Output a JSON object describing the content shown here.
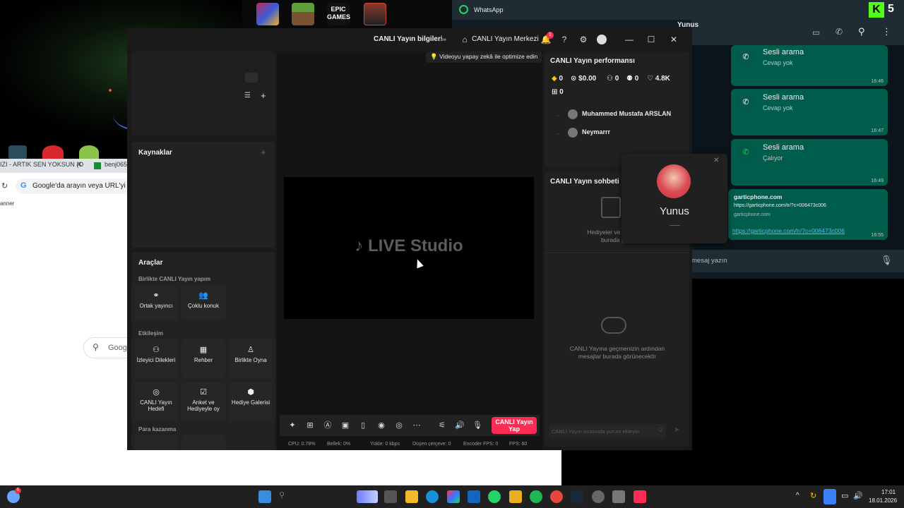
{
  "desktop": {
    "icons": [
      "game-icon-1",
      "minecraft-icon",
      "epic-games-icon",
      "game-icon-4"
    ],
    "epic_label": "EPIC\nGAMES"
  },
  "chrome": {
    "tabs": [
      "IZI - ARTIK SEN YOKSUN (O",
      "benj065"
    ],
    "omnibox": "Google'da arayın veya URL'yi yaz",
    "bookmark": "anner",
    "search_placeholder": "Goog"
  },
  "studio": {
    "titlebar": {
      "info": "CANLI Yayın bilgileri",
      "center": "CANLI Yayın Merkezi",
      "notif_count": "1"
    },
    "left": {
      "sources_title": "Kaynaklar",
      "tools_title": "Araçlar",
      "section_collab": "Birlikte CANLI Yayın yapım",
      "section_interact": "Etkileşim",
      "section_money": "Para kazanma",
      "collab_tools": [
        {
          "icon": "link-icon",
          "label": "Ortak yayıncı"
        },
        {
          "icon": "multi-guest-icon",
          "label": "Çoklu konuk"
        }
      ],
      "interact_tools": [
        {
          "icon": "viewer-requests-icon",
          "label": "İzleyici Dilekleri"
        },
        {
          "icon": "guide-icon",
          "label": "Rehber"
        },
        {
          "icon": "play-together-icon",
          "label": "Birlikte Oyna"
        },
        {
          "icon": "live-goal-icon",
          "label": "CANLI Yayın Hedefi"
        },
        {
          "icon": "poll-icon",
          "label": "Anket ve Hediyeyle oy"
        },
        {
          "icon": "gift-gallery-icon",
          "label": "Hediye Galerisi"
        }
      ]
    },
    "center": {
      "ai_tip": "Videoyu yapay zekâ ile optimize edin",
      "logo": "LIVE Studio",
      "go_live": "CANLI Yayın Yap",
      "status": {
        "cpu": "CPU: 0.78%",
        "memory": "Bellek: 0%",
        "upload": "Yükle: 0 kbps",
        "dropped": "Düşen çerçeve: 0",
        "encoder": "Encoder FPS: 0",
        "fps": "FPS: 60"
      }
    },
    "right": {
      "perf_title": "CANLI Yayın performansı",
      "stats": {
        "diamonds": "0",
        "money": "$0.00",
        "viewers": "0",
        "new_followers": "0",
        "likes": "4.8K",
        "gifts": "0"
      },
      "viewers": [
        "Muhammed Mustafa ARSLAN",
        "Neymarrr"
      ],
      "chat_title": "CANLI Yayın sohbeti",
      "gift_hint": "Hediyeler ve Süper Ha\nburada görü",
      "chat_hint": "CANLI Yayına geçmenizin ardından\nmesajlar burada görünecektir",
      "chat_input_placeholder": "CANLI Yayın sırasında yorum ekleyin"
    }
  },
  "whatsapp": {
    "title": "WhatsApp",
    "contact": "Yunus",
    "messages": [
      {
        "title": "Sesli arama",
        "sub": "Cevap yok",
        "time": "16:46"
      },
      {
        "title": "Sesli arama",
        "sub": "Cevap yok",
        "time": "16:47"
      },
      {
        "title": "Sesli arama",
        "sub": "Çalıyor",
        "time": "16:49"
      }
    ],
    "link_preview": {
      "title": "garticphone.com",
      "url": "https://garticphone.com/tr/?c=006473c006",
      "domain": "garticphone.com",
      "link": "https://garticphone.com/tr/?c=006473c006",
      "time": "16:55"
    },
    "input_placeholder": "mesaj yazın",
    "badge": "5"
  },
  "call": {
    "name": "Yunus",
    "status": "..............."
  },
  "taskbar": {
    "time": "17:01",
    "date": "18.01.2026",
    "weather_badge": "5"
  },
  "colors": {
    "accent": "#fe2c55",
    "wa_green": "#005c4b",
    "panel": "#1a1a1a"
  }
}
